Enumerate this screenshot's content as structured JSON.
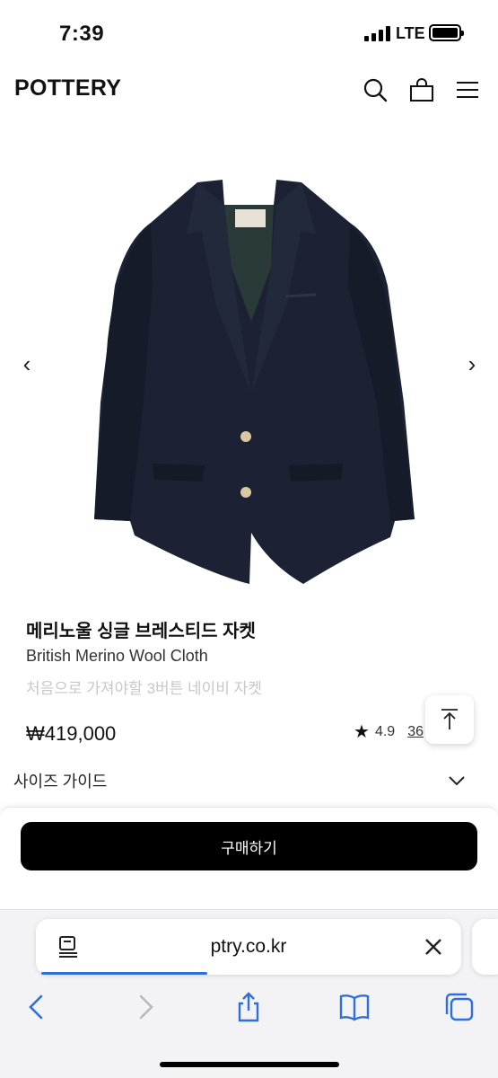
{
  "status_bar": {
    "time": "7:39",
    "network": "LTE"
  },
  "header": {
    "logo": "POTTERY",
    "icons": [
      "search-icon",
      "shopping-bag-icon",
      "menu-icon"
    ]
  },
  "gallery": {
    "prev_arrow": "‹",
    "next_arrow": "›"
  },
  "product": {
    "title": "메리노울 싱글 브레스티드 자켓",
    "subtitle": "British Merino Wool Cloth",
    "description": "처음으로 가져야할 3버튼 네이비 자켓",
    "price": "₩419,000",
    "rating": "4.9",
    "review_count": "36"
  },
  "size_guide": {
    "label": "사이즈 가이드"
  },
  "buy": {
    "label": "구매하기"
  },
  "browser": {
    "url": "ptry.co.kr",
    "load_progress": 0.4
  },
  "colors": {
    "accent": "#2f6fd8",
    "navy": "#1c2233"
  }
}
